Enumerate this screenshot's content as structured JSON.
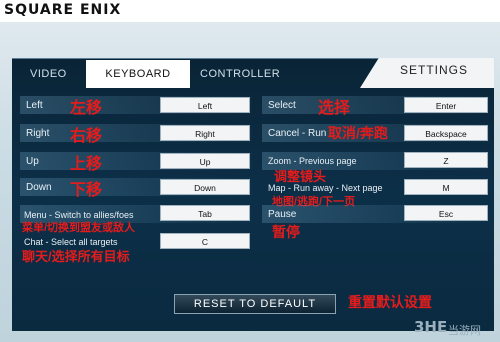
{
  "brand": "SQUARE ENIX",
  "tabs": {
    "video": "VIDEO",
    "keyboard": "KEYBOARD",
    "controller": "CONTROLLER",
    "settings": "SETTINGS"
  },
  "left": {
    "left_label": "Left",
    "left_key": "Left",
    "left_cn": "左移",
    "right_label": "Right",
    "right_key": "Right",
    "right_cn": "右移",
    "up_label": "Up",
    "up_key": "Up",
    "up_cn": "上移",
    "down_label": "Down",
    "down_key": "Down",
    "down_cn": "下移",
    "menu_label": "Menu - Switch to allies/foes",
    "menu_key": "Tab",
    "menu_cn": "菜单/切换到盟友或敌人",
    "chat_label": "Chat - Select all targets",
    "chat_key": "C",
    "chat_cn": "聊天/选择所有目标"
  },
  "right": {
    "select_label": "Select",
    "select_key": "Enter",
    "select_cn": "选择",
    "cancel_label": "Cancel - Run",
    "cancel_key": "Backspace",
    "cancel_cn": "取消/奔跑",
    "zoom_label": "Zoom - Previous page",
    "zoom_key": "Z",
    "zoom_cn": "调整镜头",
    "map_label": "Map - Run away - Next page",
    "map_key": "M",
    "map_cn": "地图/逃跑/下一页",
    "pause_label": "Pause",
    "pause_key": "Esc",
    "pause_cn": "暂停"
  },
  "reset_label": "RESET TO DEFAULT",
  "reset_cn": "重置默认设置",
  "footer": {
    "logo": "3HE",
    "site": "当游网"
  }
}
